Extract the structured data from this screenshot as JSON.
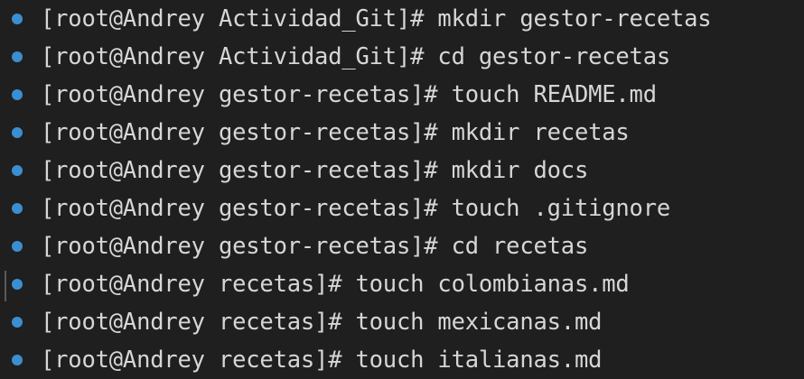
{
  "terminal": {
    "prompt_user": "root",
    "prompt_host": "Andrey",
    "status_color": "#3b8fd0",
    "lines": [
      {
        "cwd": "Actividad_Git",
        "command": "mkdir gestor-recetas",
        "text": "[root@Andrey Actividad_Git]# mkdir gestor-recetas"
      },
      {
        "cwd": "Actividad_Git",
        "command": "cd gestor-recetas",
        "text": "[root@Andrey Actividad_Git]# cd gestor-recetas"
      },
      {
        "cwd": "gestor-recetas",
        "command": "touch README.md",
        "text": "[root@Andrey gestor-recetas]# touch README.md"
      },
      {
        "cwd": "gestor-recetas",
        "command": "mkdir recetas",
        "text": "[root@Andrey gestor-recetas]# mkdir recetas"
      },
      {
        "cwd": "gestor-recetas",
        "command": "mkdir docs",
        "text": "[root@Andrey gestor-recetas]# mkdir docs"
      },
      {
        "cwd": "gestor-recetas",
        "command": "touch .gitignore",
        "text": "[root@Andrey gestor-recetas]# touch .gitignore"
      },
      {
        "cwd": "gestor-recetas",
        "command": "cd recetas",
        "text": "[root@Andrey gestor-recetas]# cd recetas"
      },
      {
        "cwd": "recetas",
        "command": "touch colombianas.md",
        "text": "[root@Andrey recetas]# touch colombianas.md"
      },
      {
        "cwd": "recetas",
        "command": "touch mexicanas.md",
        "text": "[root@Andrey recetas]# touch mexicanas.md"
      },
      {
        "cwd": "recetas",
        "command": "touch italianas.md",
        "text": "[root@Andrey recetas]# touch italianas.md"
      }
    ]
  }
}
